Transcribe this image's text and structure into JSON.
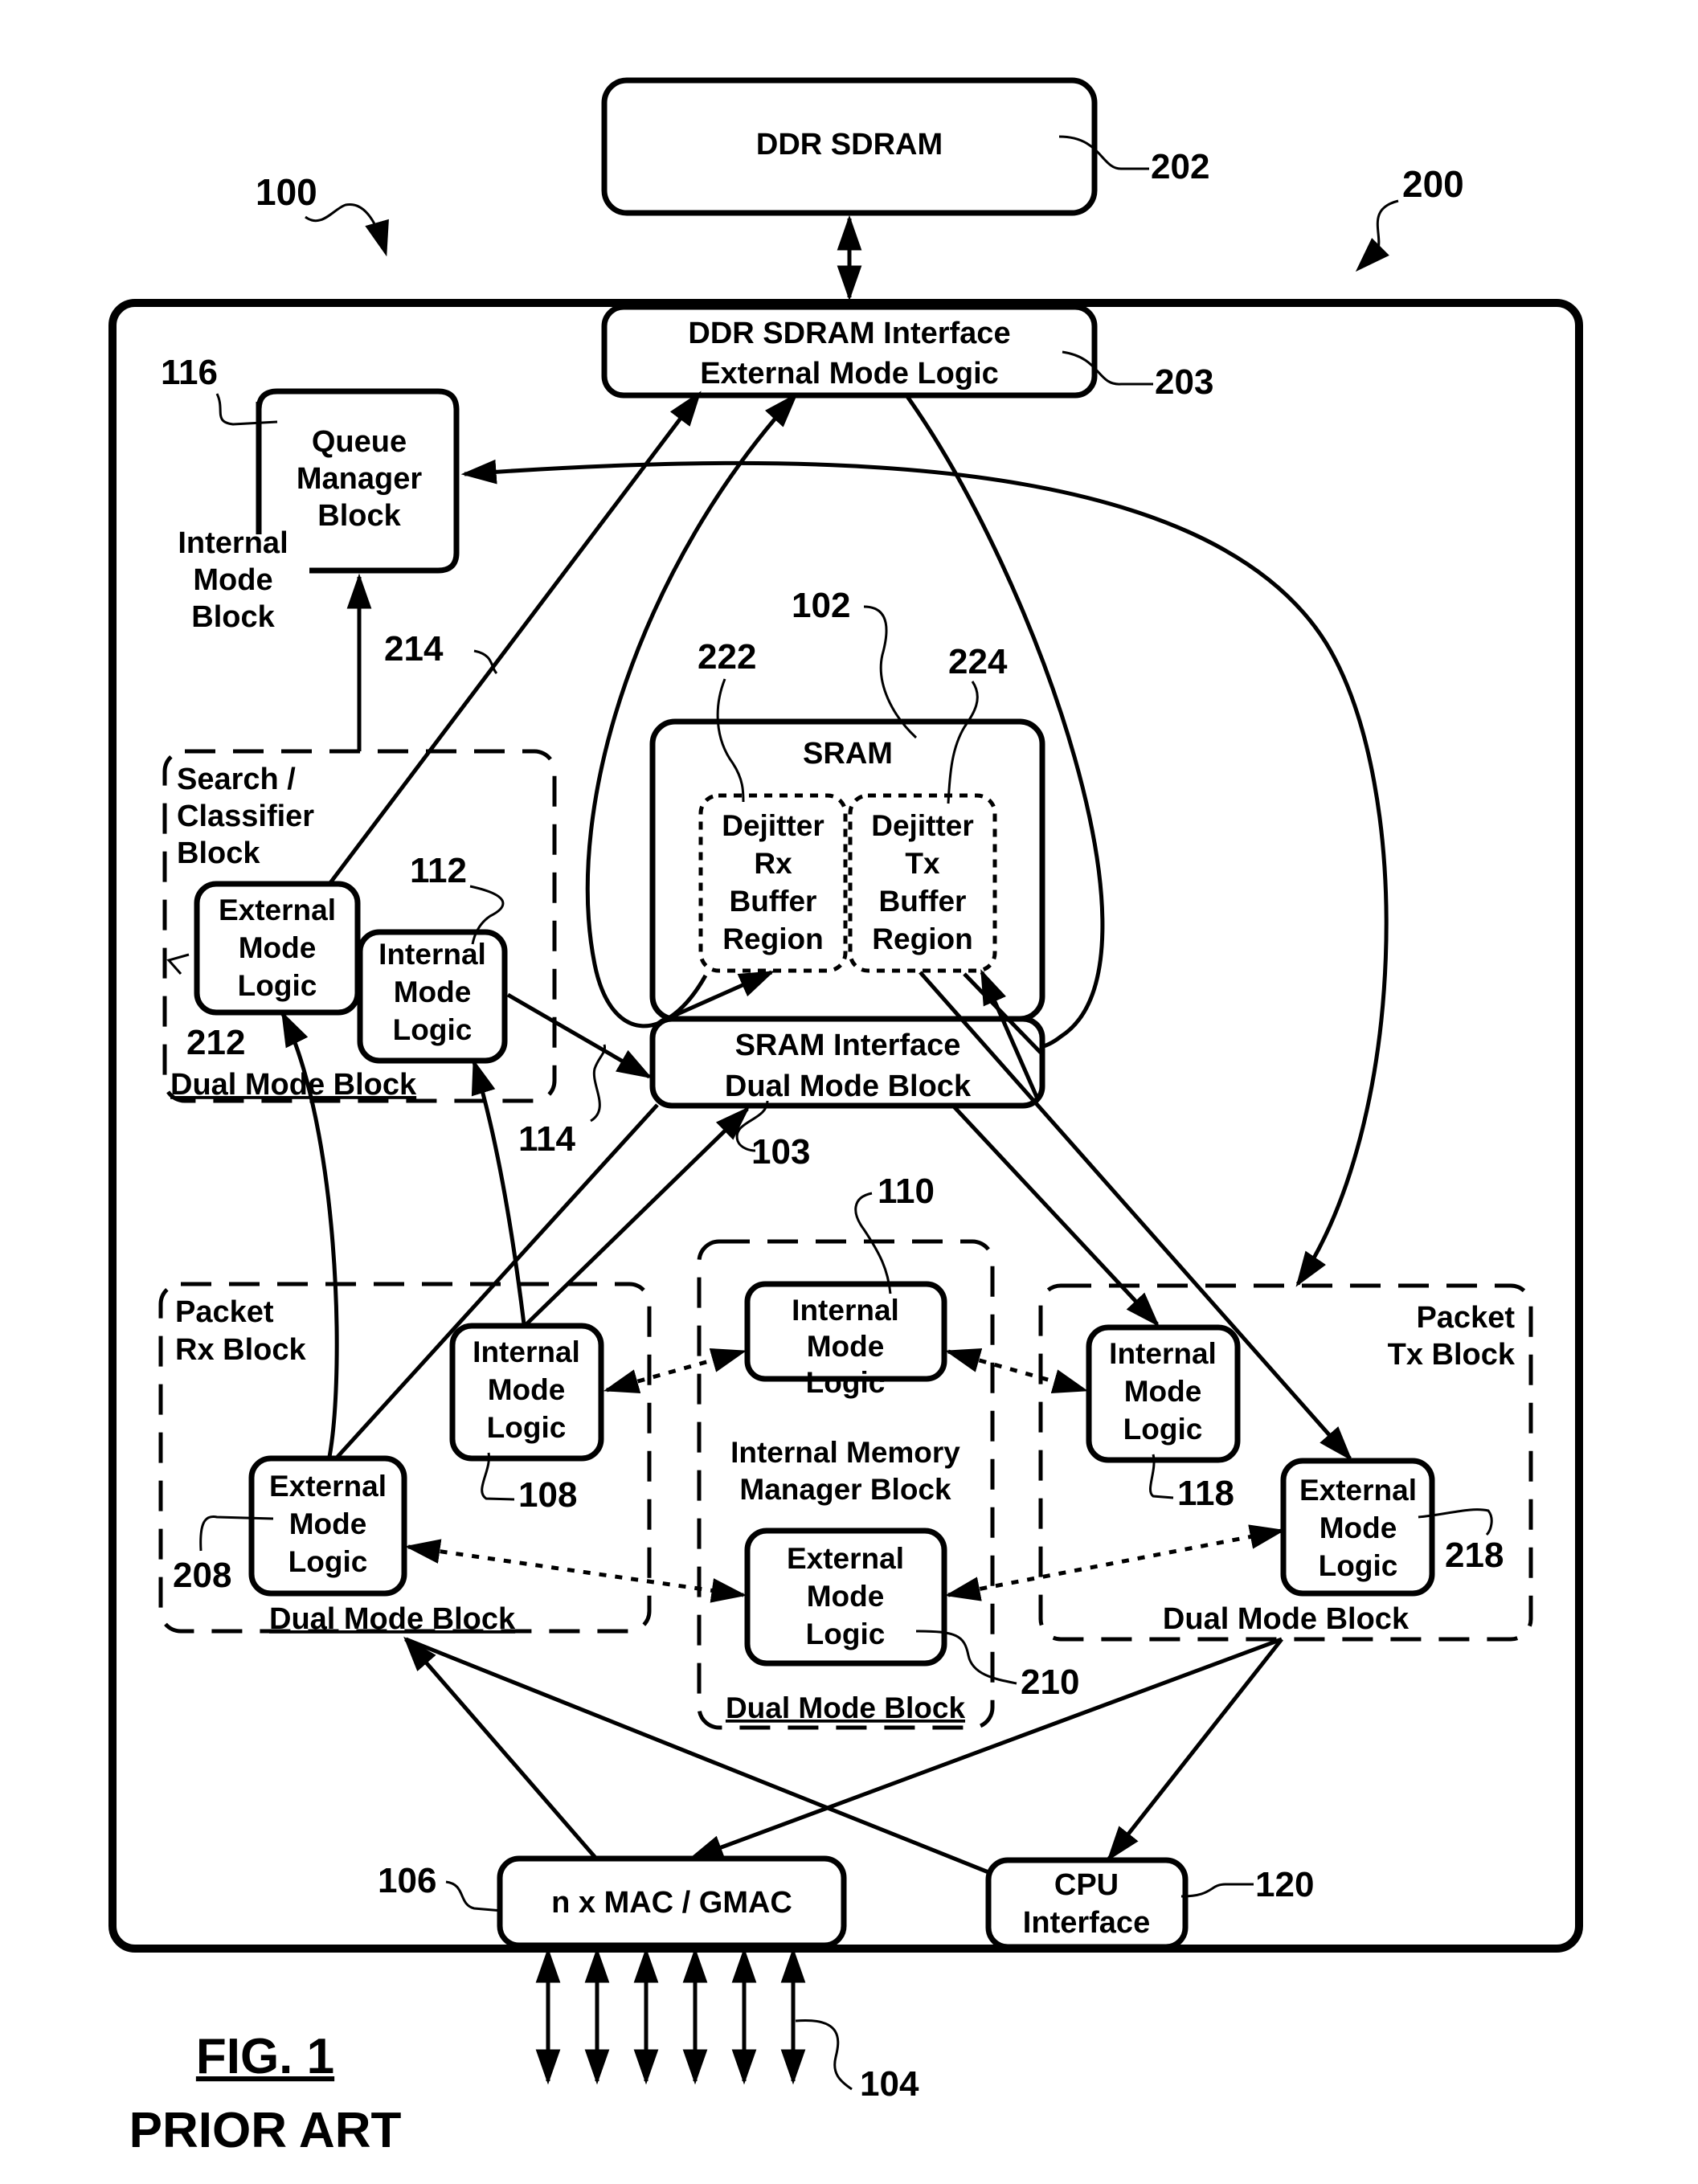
{
  "figure": {
    "caption": "FIG. 1",
    "subcaption": "PRIOR ART"
  },
  "ref_numbers": {
    "system_100": "100",
    "system_200": "200",
    "ddr_sdram": "202",
    "ddr_interface": "203",
    "queue_manager": "116",
    "sram": "102",
    "dejitter_rx": "222",
    "dejitter_tx": "224",
    "sram_interface": "103",
    "search_internal": "112",
    "search_external": "212",
    "link_214": "214",
    "link_114": "114",
    "imm_internal": "110",
    "imm_external": "210",
    "rx_internal": "108",
    "rx_external": "208",
    "tx_internal": "118",
    "tx_external": "218",
    "mac": "106",
    "cpu": "120",
    "ports": "104"
  },
  "blocks": {
    "ddr_sdram": {
      "label": "DDR SDRAM"
    },
    "ddr_interface": {
      "line1": "DDR SDRAM Interface",
      "line2": "External Mode Logic"
    },
    "queue_manager": {
      "line1": "Queue",
      "line2": "Manager",
      "line3": "Block",
      "side1": "Internal",
      "side2": "Mode",
      "side3": "Block"
    },
    "sram": {
      "label": "SRAM"
    },
    "dejitter_rx": {
      "line1": "Dejitter",
      "line2": "Rx",
      "line3": "Buffer",
      "line4": "Region"
    },
    "dejitter_tx": {
      "line1": "Dejitter",
      "line2": "Tx",
      "line3": "Buffer",
      "line4": "Region"
    },
    "sram_interface": {
      "line1": "SRAM Interface",
      "line2": "Dual Mode Block"
    },
    "search_classifier": {
      "line1": "Search /",
      "line2": "Classifier",
      "line3": "Block",
      "footer": "Dual Mode Block"
    },
    "packet_rx": {
      "line1": "Packet",
      "line2": "Rx Block",
      "footer": "Dual Mode Block"
    },
    "imm": {
      "line1": "Internal Memory",
      "line2": "Manager Block",
      "footer": "Dual Mode Block"
    },
    "packet_tx": {
      "line1": "Packet",
      "line2": "Tx Block",
      "footer": "Dual Mode Block"
    },
    "internal_logic": {
      "line1": "Internal",
      "line2": "Mode",
      "line3": "Logic"
    },
    "external_logic": {
      "line1": "External",
      "line2": "Mode",
      "line3": "Logic"
    },
    "mac": {
      "label": "n x MAC / GMAC"
    },
    "cpu": {
      "line1": "CPU",
      "line2": "Interface"
    }
  }
}
